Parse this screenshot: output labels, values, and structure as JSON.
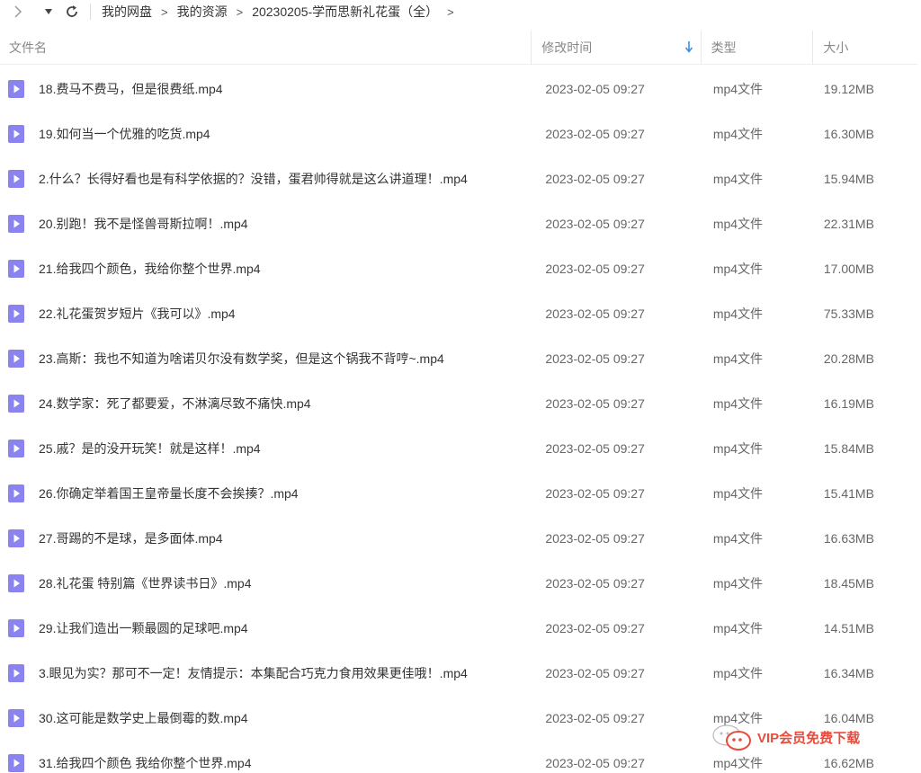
{
  "toolbar": {
    "back_icon": "chevron-right-icon",
    "dropdown_icon": "caret-down-icon",
    "refresh_icon": "refresh-icon"
  },
  "breadcrumb": [
    "我的网盘",
    "我的资源",
    "20230205-学而思新礼花蛋（全）"
  ],
  "columns": {
    "name": "文件名",
    "time": "修改时间",
    "type": "类型",
    "size": "大小"
  },
  "files": [
    {
      "name": "18.费马不费马，但是很费纸.mp4",
      "time": "2023-02-05 09:27",
      "type": "mp4文件",
      "size": "19.12MB"
    },
    {
      "name": "19.如何当一个优雅的吃货.mp4",
      "time": "2023-02-05 09:27",
      "type": "mp4文件",
      "size": "16.30MB"
    },
    {
      "name": "2.什么？长得好看也是有科学依据的？没错，蛋君帅得就是这么讲道理！.mp4",
      "time": "2023-02-05 09:27",
      "type": "mp4文件",
      "size": "15.94MB"
    },
    {
      "name": "20.别跑！我不是怪兽哥斯拉啊！.mp4",
      "time": "2023-02-05 09:27",
      "type": "mp4文件",
      "size": "22.31MB"
    },
    {
      "name": "21.给我四个颜色，我给你整个世界.mp4",
      "time": "2023-02-05 09:27",
      "type": "mp4文件",
      "size": "17.00MB"
    },
    {
      "name": "22.礼花蛋贺岁短片《我可以》.mp4",
      "time": "2023-02-05 09:27",
      "type": "mp4文件",
      "size": "75.33MB"
    },
    {
      "name": "23.高斯：我也不知道为啥诺贝尔没有数学奖，但是这个锅我不背哼~.mp4",
      "time": "2023-02-05 09:27",
      "type": "mp4文件",
      "size": "20.28MB"
    },
    {
      "name": "24.数学家：死了都要爱，不淋漓尽致不痛快.mp4",
      "time": "2023-02-05 09:27",
      "type": "mp4文件",
      "size": "16.19MB"
    },
    {
      "name": "25.戚？是的没开玩笑！就是这样！.mp4",
      "time": "2023-02-05 09:27",
      "type": "mp4文件",
      "size": "15.84MB"
    },
    {
      "name": "26.你确定举着国王皇帝量长度不会挨揍？.mp4",
      "time": "2023-02-05 09:27",
      "type": "mp4文件",
      "size": "15.41MB"
    },
    {
      "name": "27.哥踢的不是球，是多面体.mp4",
      "time": "2023-02-05 09:27",
      "type": "mp4文件",
      "size": "16.63MB"
    },
    {
      "name": "28.礼花蛋 特别篇《世界读书日》.mp4",
      "time": "2023-02-05 09:27",
      "type": "mp4文件",
      "size": "18.45MB"
    },
    {
      "name": "29.让我们造出一颗最圆的足球吧.mp4",
      "time": "2023-02-05 09:27",
      "type": "mp4文件",
      "size": "14.51MB"
    },
    {
      "name": "3.眼见为实？那可不一定！友情提示：本集配合巧克力食用效果更佳哦！.mp4",
      "time": "2023-02-05 09:27",
      "type": "mp4文件",
      "size": "16.34MB"
    },
    {
      "name": "30.这可能是数学史上最倒霉的数.mp4",
      "time": "2023-02-05 09:27",
      "type": "mp4文件",
      "size": "16.04MB"
    },
    {
      "name": "31.给我四个颜色 我给你整个世界.mp4",
      "time": "2023-02-05 09:27",
      "type": "mp4文件",
      "size": "16.62MB"
    }
  ],
  "watermark": {
    "text": "VIP会员免费下载",
    "icon": "wechat-chat-icon"
  },
  "colors": {
    "file_icon": "#8b83f0",
    "sort_arrow": "#3a8ee6",
    "watermark": "#e84c3d"
  }
}
